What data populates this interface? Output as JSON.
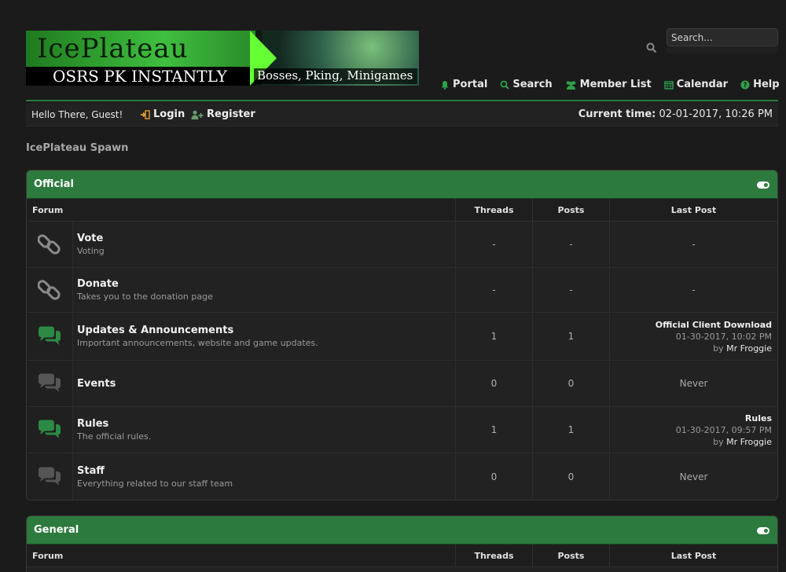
{
  "logo": {
    "title": "IcePlateau",
    "tagline": "OSRS PK INSTANTLY",
    "subtitle": "Bosses, Pking, Minigames"
  },
  "search": {
    "placeholder": "Search..."
  },
  "menu": [
    {
      "label": "Portal",
      "icon": "bell-icon"
    },
    {
      "label": "Search",
      "icon": "search-icon"
    },
    {
      "label": "Member List",
      "icon": "users-icon"
    },
    {
      "label": "Calendar",
      "icon": "calendar-icon"
    },
    {
      "label": "Help",
      "icon": "help-icon"
    }
  ],
  "welcome": {
    "greeting": "Hello There, Guest!",
    "login": "Login",
    "register": "Register",
    "time_label": "Current time:",
    "time_value": "02-01-2017, 10:26 PM"
  },
  "breadcrumb": "IcePlateau Spawn",
  "columns": {
    "forum": "Forum",
    "threads": "Threads",
    "posts": "Posts",
    "last_post": "Last Post"
  },
  "categories": [
    {
      "title": "Official",
      "forums": [
        {
          "name": "Vote",
          "desc": "Voting",
          "icon": "link-icon",
          "threads": "-",
          "posts": "-",
          "last": "-"
        },
        {
          "name": "Donate",
          "desc": "Takes you to the donation page",
          "icon": "link-icon",
          "threads": "-",
          "posts": "-",
          "last": "-"
        },
        {
          "name": "Updates & Announcements",
          "desc": "Important announcements, website and game updates.",
          "icon": "chat-icon",
          "active": true,
          "threads": "1",
          "posts": "1",
          "last_title": "Official Client Download",
          "last_date": "01-30-2017, 10:02 PM",
          "last_by": "by",
          "last_user": "Mr Froggie"
        },
        {
          "name": "Events",
          "desc": "",
          "icon": "chat-icon",
          "active": false,
          "threads": "0",
          "posts": "0",
          "last": "Never"
        },
        {
          "name": "Rules",
          "desc": "The official rules.",
          "icon": "chat-icon",
          "active": true,
          "threads": "1",
          "posts": "1",
          "last_title": "Rules",
          "last_date": "01-30-2017, 09:57 PM",
          "last_by": "by",
          "last_user": "Mr Froggie"
        },
        {
          "name": "Staff",
          "desc": "Everything related to our staff team",
          "icon": "chat-icon",
          "active": false,
          "threads": "0",
          "posts": "0",
          "last": "Never"
        }
      ]
    },
    {
      "title": "General"
    }
  ],
  "colors": {
    "accent": "#2c7a3e",
    "bg": "#1b1b1b",
    "panel": "#222222"
  }
}
